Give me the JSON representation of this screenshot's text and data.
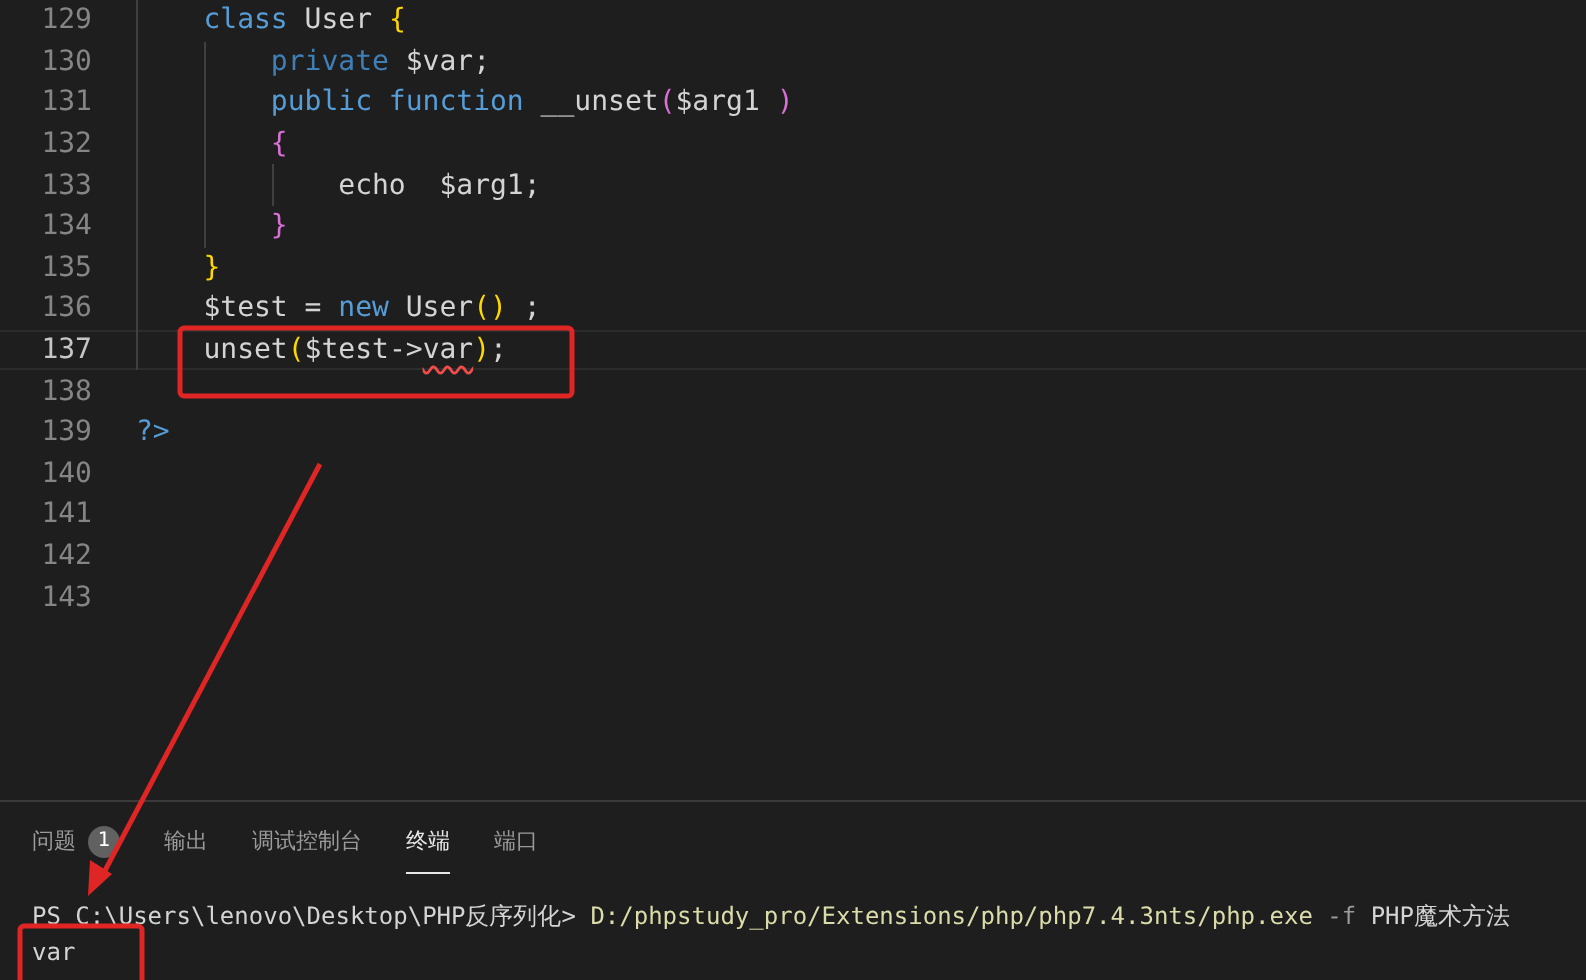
{
  "editor": {
    "lines": [
      {
        "number": "129",
        "current": false,
        "tokens": [
          {
            "text": "    class",
            "kind": "keyword"
          },
          {
            "text": " User ",
            "kind": "plain"
          },
          {
            "text": "{",
            "kind": "bracket1"
          }
        ]
      },
      {
        "number": "130",
        "current": false,
        "tokens": [
          {
            "text": "        private",
            "kind": "storage"
          },
          {
            "text": " $var;",
            "kind": "plain"
          }
        ]
      },
      {
        "number": "131",
        "current": false,
        "tokens": [
          {
            "text": "        public function",
            "kind": "keyword"
          },
          {
            "text": " __unset",
            "kind": "plain"
          },
          {
            "text": "(",
            "kind": "bracket2"
          },
          {
            "text": "$arg1 ",
            "kind": "plain"
          },
          {
            "text": ")",
            "kind": "bracket2"
          }
        ]
      },
      {
        "number": "132",
        "current": false,
        "tokens": [
          {
            "text": "        {",
            "kind": "bracket2"
          }
        ]
      },
      {
        "number": "133",
        "current": false,
        "tokens": [
          {
            "text": "            echo  $arg1;",
            "kind": "plain"
          }
        ]
      },
      {
        "number": "134",
        "current": false,
        "tokens": [
          {
            "text": "        }",
            "kind": "bracket2"
          }
        ]
      },
      {
        "number": "135",
        "current": false,
        "tokens": [
          {
            "text": "    }",
            "kind": "bracket1"
          }
        ]
      },
      {
        "number": "136",
        "current": false,
        "tokens": [
          {
            "text": "    $test = ",
            "kind": "plain"
          },
          {
            "text": "new",
            "kind": "keyword"
          },
          {
            "text": " User",
            "kind": "plain"
          },
          {
            "text": "()",
            "kind": "bracket1"
          },
          {
            "text": " ;",
            "kind": "plain"
          }
        ]
      },
      {
        "number": "137",
        "current": true,
        "tokens": [
          {
            "text": "    unset",
            "kind": "plain"
          },
          {
            "text": "(",
            "kind": "bracket1"
          },
          {
            "text": "$test->",
            "kind": "plain"
          },
          {
            "text": "var",
            "kind": "plain",
            "squiggle": true
          },
          {
            "text": ")",
            "kind": "bracket1"
          },
          {
            "text": ";",
            "kind": "plain"
          }
        ]
      },
      {
        "number": "138",
        "current": false
      },
      {
        "number": "139",
        "current": false,
        "tokens": [
          {
            "text": "?>",
            "kind": "keyword"
          }
        ]
      },
      {
        "number": "140",
        "current": false
      },
      {
        "number": "141",
        "current": false
      },
      {
        "number": "142",
        "current": false
      },
      {
        "number": "143",
        "current": false
      }
    ]
  },
  "panel": {
    "tabs": [
      {
        "label": "问题",
        "badge": "1",
        "selected": false
      },
      {
        "label": "输出",
        "selected": false
      },
      {
        "label": "调试控制台",
        "selected": false
      },
      {
        "label": "终端",
        "selected": true
      },
      {
        "label": "端口",
        "selected": false
      }
    ],
    "terminal": [
      [
        {
          "text": "PS C:\\Users\\lenovo\\Desktop\\PHP反序列化> ",
          "kind": "plain"
        },
        {
          "text": "D:/phpstudy_pro/Extensions/php/php7.4.3nts/php.exe",
          "kind": "command"
        },
        {
          "text": " -f ",
          "kind": "flag"
        },
        {
          "text": "PHP魔术方法",
          "kind": "plain"
        }
      ],
      [
        {
          "text": "var",
          "kind": "plain"
        }
      ]
    ]
  }
}
